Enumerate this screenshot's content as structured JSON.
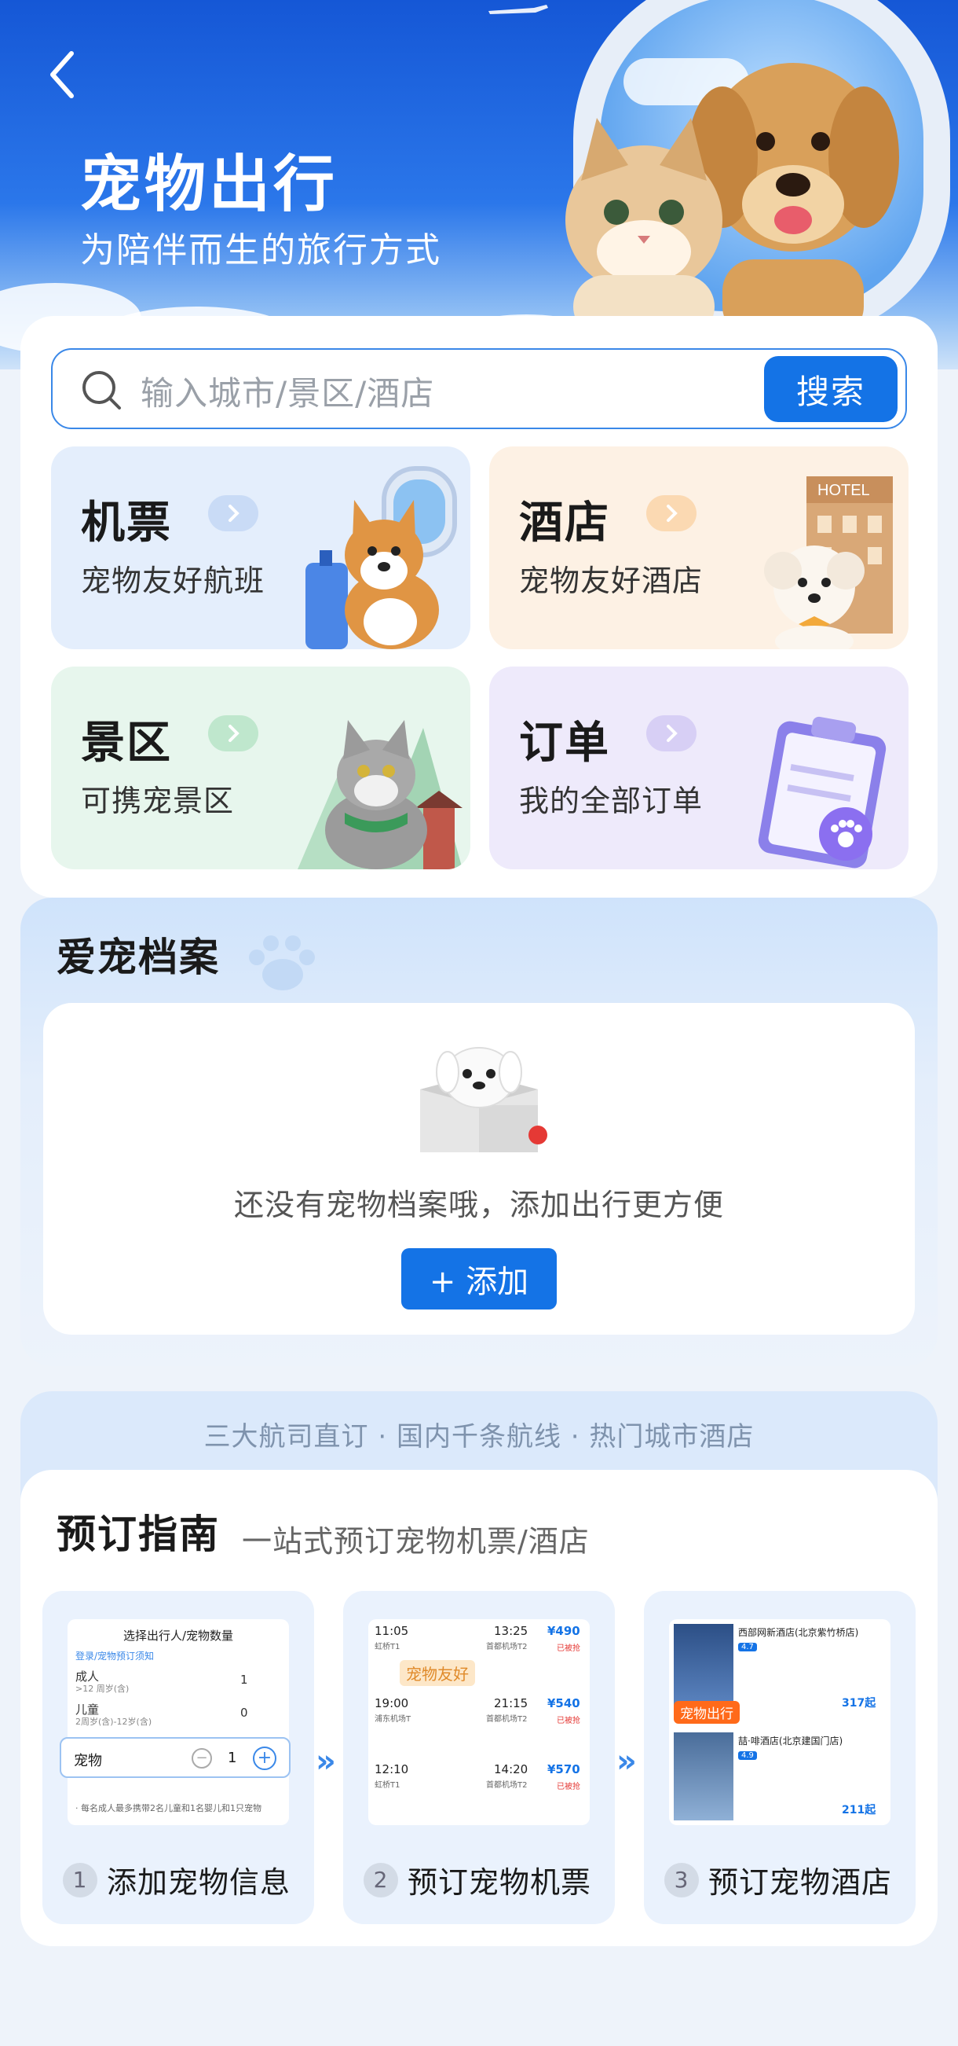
{
  "header": {
    "title": "宠物出行",
    "subtitle": "为陪伴而生的旅行方式"
  },
  "search": {
    "placeholder": "输入城市/景区/酒店",
    "button": "搜索"
  },
  "tiles": [
    {
      "title": "机票",
      "subtitle": "宠物友好航班",
      "bg": "#e4eefc",
      "chev": "#c9dbf6"
    },
    {
      "title": "酒店",
      "subtitle": "宠物友好酒店",
      "bg": "#fdf1e4",
      "chev": "#fbd9b2"
    },
    {
      "title": "景区",
      "subtitle": "可携宠景区",
      "bg": "#e7f6ed",
      "chev": "#bfe7cd"
    },
    {
      "title": "订单",
      "subtitle": "我的全部订单",
      "bg": "#eeeafb",
      "chev": "#d7cff5"
    }
  ],
  "pet_profile": {
    "title": "爱宠档案",
    "empty_text": "还没有宠物档案哦，添加出行更方便",
    "add_button": "+ 添加"
  },
  "guide": {
    "banner": "三大航司直订 · 国内千条航线 · 热门城市酒店",
    "title": "预订指南",
    "subtitle": "一站式预订宠物机票/酒店",
    "steps": [
      {
        "num": "1",
        "label": "添加宠物信息"
      },
      {
        "num": "2",
        "label": "预订宠物机票"
      },
      {
        "num": "3",
        "label": "预订宠物酒店"
      }
    ],
    "step1_shot": {
      "header": "选择出行人/宠物数量",
      "notice": "登录/宠物预订须知",
      "adult": "成人",
      "adult_note": ">12 周岁(含)",
      "adult_count": "1",
      "child": "儿童",
      "child_note": "2周岁(含)-12岁(含)",
      "child_count": "0",
      "pet": "宠物",
      "pet_count": "1",
      "footer": "· 每名成人最多携带2名儿童和1名婴儿和1只宠物"
    },
    "step2_shot": {
      "badge": "宠物友好",
      "flights": [
        {
          "dep": "11:05",
          "arr": "13:25",
          "from": "虹桥T1",
          "to": "首都机场T2",
          "price": "¥490",
          "tag": "已被抢"
        },
        {
          "dep": "19:00",
          "arr": "21:15",
          "from": "浦东机场T",
          "to": "首都机场T2",
          "price": "¥540",
          "tag": "已被抢"
        },
        {
          "dep": "12:10",
          "arr": "14:20",
          "from": "虹桥T1",
          "to": "首都机场T2",
          "price": "¥570",
          "tag": "已被抢"
        }
      ]
    },
    "step3_shot": {
      "badge": "宠物出行",
      "hotels": [
        {
          "name": "西部网新酒店(北京紫竹桥店)",
          "score": "4.7",
          "price": "317起"
        },
        {
          "name": "喆·啡酒店(北京建国门店)",
          "score": "4.9",
          "price": "211起"
        }
      ]
    }
  }
}
